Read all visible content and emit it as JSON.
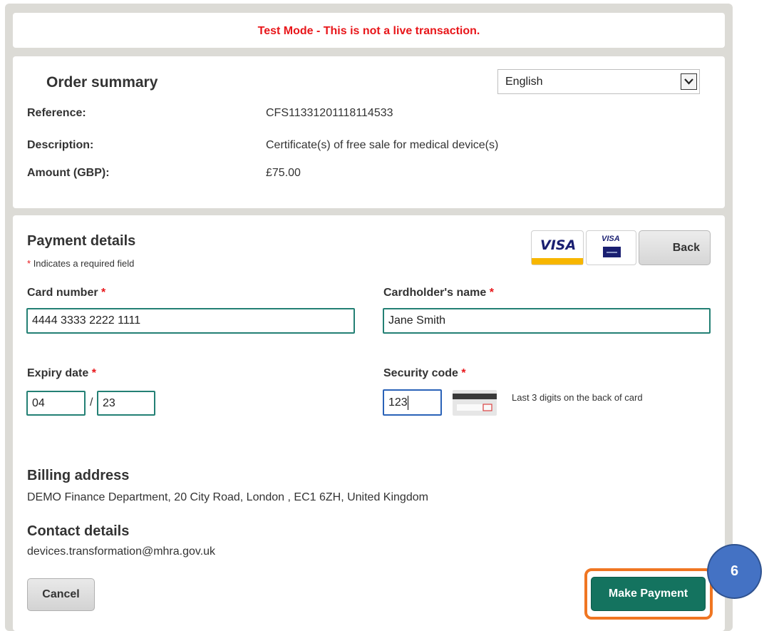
{
  "banner": {
    "text": "Test Mode - This is not a live transaction."
  },
  "order_summary": {
    "title": "Order summary",
    "language": {
      "selected": "English"
    },
    "rows": [
      {
        "label": "Reference:",
        "value": "CFS11331201118114533"
      },
      {
        "label": "Description:",
        "value": "Certificate(s) of free sale for medical device(s)"
      },
      {
        "label": "Amount (GBP):",
        "value": "£75.00"
      }
    ]
  },
  "payment": {
    "title": "Payment details",
    "required_mark": "*",
    "required_note": "Indicates a required field",
    "card_logos": [
      {
        "name": "visa-logo",
        "text": "VISA"
      },
      {
        "name": "visa-debit-logo",
        "text": "VISA"
      }
    ],
    "back_label": "Back",
    "card_number": {
      "label": "Card number",
      "value": "4444 3333 2222 1111"
    },
    "cardholder": {
      "label": "Cardholder's name",
      "value": "Jane Smith"
    },
    "expiry": {
      "label": "Expiry date",
      "month": "04",
      "separator": "/",
      "year": "23"
    },
    "security": {
      "label": "Security code",
      "value": "123",
      "hint": "Last 3 digits on the back of card"
    },
    "billing": {
      "title": "Billing address",
      "text": "DEMO Finance Department, 20 City Road, London , EC1 6ZH, United Kingdom"
    },
    "contact": {
      "title": "Contact details",
      "text": "devices.transformation@mhra.gov.uk"
    },
    "cancel_label": "Cancel",
    "pay_label": "Make Payment"
  },
  "annotation": {
    "step": "6"
  },
  "colors": {
    "accent": "#14735f",
    "error": "#e8161a",
    "highlight": "#f07622",
    "badge": "#4472c4"
  }
}
